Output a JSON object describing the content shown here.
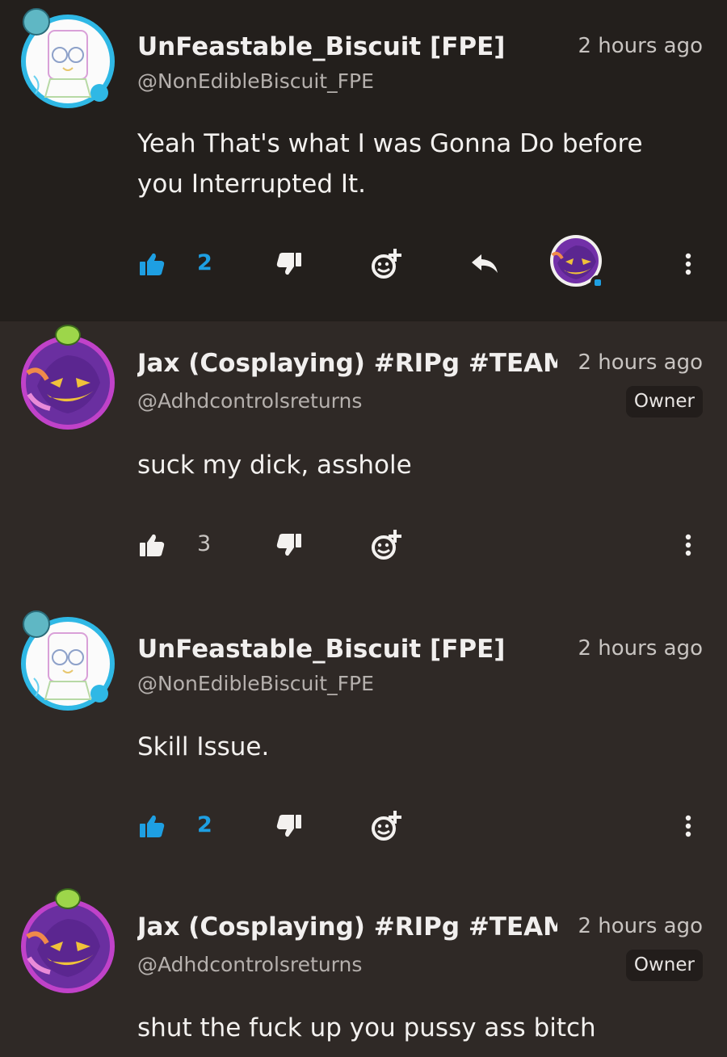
{
  "comments": [
    {
      "author": "UnFeastable_Biscuit [FPE]",
      "handle": "@NonEdibleBiscuit_FPE",
      "time": "2 hours ago",
      "text_lines": [
        "Yeah That's what I was Gonna Do before",
        "you Interrupted It."
      ],
      "likes": "2",
      "liked": true,
      "avatar_icon": "biscuit-avatar-icon"
    },
    {
      "author": "Jax (Cosplaying) #RIPg #TEAM",
      "handle": "@Adhdcontrolsreturns",
      "time": "2 hours ago",
      "badge": "Owner",
      "text_lines": [
        "suck my dick, asshole"
      ],
      "likes": "3",
      "liked": false,
      "avatar_icon": "jax-avatar-icon"
    },
    {
      "author": "UnFeastable_Biscuit [FPE]",
      "handle": "@NonEdibleBiscuit_FPE",
      "time": "2 hours ago",
      "text_lines": [
        "Skill Issue."
      ],
      "likes": "2",
      "liked": true,
      "avatar_icon": "biscuit-avatar-icon"
    },
    {
      "author": "Jax (Cosplaying) #RIPg #TEAM",
      "handle": "@Adhdcontrolsreturns",
      "time": "2 hours ago",
      "badge": "Owner",
      "text_lines": [
        "shut the fuck up you pussy ass bitch"
      ],
      "avatar_icon": "jax-avatar-icon"
    }
  ],
  "colors": {
    "accent_blue": "#1e9fe2",
    "highlight_bg": "#231f1c",
    "page_bg": "#2f2926"
  },
  "icons": {
    "like": "thumbs-up-icon",
    "dislike": "thumbs-down-icon",
    "react": "emoji-add-icon",
    "reply": "reply-arrow-icon",
    "more": "more-vertical-icon"
  }
}
